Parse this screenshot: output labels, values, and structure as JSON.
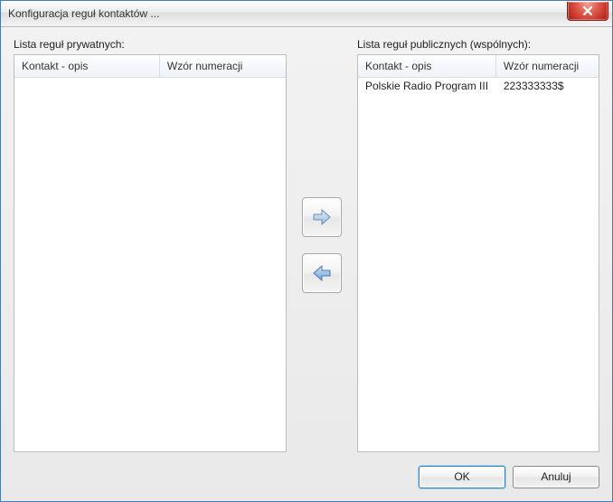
{
  "window": {
    "title": "Konfiguracja reguł kontaktów ..."
  },
  "labels": {
    "private_list": "Lista reguł prywatnych:",
    "public_list": "Lista reguł publicznych (wspólnych):"
  },
  "columns": {
    "contact": "Kontakt - opis",
    "pattern": "Wzór numeracji"
  },
  "private_rules": [],
  "public_rules": [
    {
      "contact": "Polskie Radio Program III",
      "pattern": "223333333$"
    }
  ],
  "buttons": {
    "ok": "OK",
    "cancel": "Anuluj"
  }
}
